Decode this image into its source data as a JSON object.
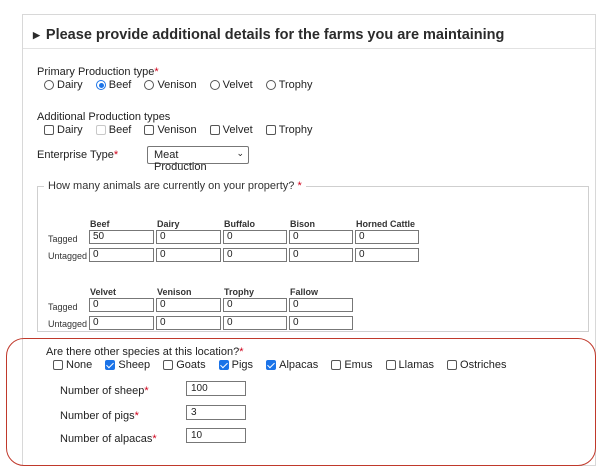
{
  "header": {
    "title": "Please provide additional details for the farms you are maintaining"
  },
  "primary": {
    "label": "Primary Production type",
    "required_mark": "*",
    "options": [
      "Dairy",
      "Beef",
      "Venison",
      "Velvet",
      "Trophy"
    ],
    "selected": "Beef"
  },
  "additional": {
    "label": "Additional Production types",
    "options": [
      "Dairy",
      "Beef",
      "Venison",
      "Velvet",
      "Trophy"
    ]
  },
  "enterprise": {
    "label": "Enterprise Type",
    "required_mark": "*",
    "value": "Meat Production"
  },
  "animals": {
    "legend": "How many animals are currently on your property?",
    "required_mark": "*",
    "table1": {
      "columns": [
        "Beef",
        "Dairy",
        "Buffalo",
        "Bison",
        "Horned Cattle"
      ],
      "rows": [
        {
          "label": "Tagged",
          "values": [
            "50",
            "0",
            "0",
            "0",
            "0"
          ]
        },
        {
          "label": "Untagged",
          "values": [
            "0",
            "0",
            "0",
            "0",
            "0"
          ]
        }
      ]
    },
    "table2": {
      "columns": [
        "Velvet",
        "Venison",
        "Trophy",
        "Fallow"
      ],
      "rows": [
        {
          "label": "Tagged",
          "values": [
            "0",
            "0",
            "0",
            "0"
          ]
        },
        {
          "label": "Untagged",
          "values": [
            "0",
            "0",
            "0",
            "0"
          ]
        }
      ]
    }
  },
  "species": {
    "label": "Are there other species at this location?",
    "required_mark": "*",
    "options": [
      {
        "label": "None",
        "checked": false
      },
      {
        "label": "Sheep",
        "checked": true
      },
      {
        "label": "Goats",
        "checked": false
      },
      {
        "label": "Pigs",
        "checked": true
      },
      {
        "label": "Alpacas",
        "checked": true
      },
      {
        "label": "Emus",
        "checked": false
      },
      {
        "label": "Llamas",
        "checked": false
      },
      {
        "label": "Ostriches",
        "checked": false
      }
    ],
    "counts": [
      {
        "label": "Number of sheep",
        "required_mark": "*",
        "value": "100"
      },
      {
        "label": "Number of pigs",
        "required_mark": "*",
        "value": "3"
      },
      {
        "label": "Number of alpacas",
        "required_mark": "*",
        "value": "10"
      }
    ]
  },
  "colors": {
    "accent": "#1a73e8",
    "required": "#d0021b",
    "highlight": "#c0392b"
  }
}
